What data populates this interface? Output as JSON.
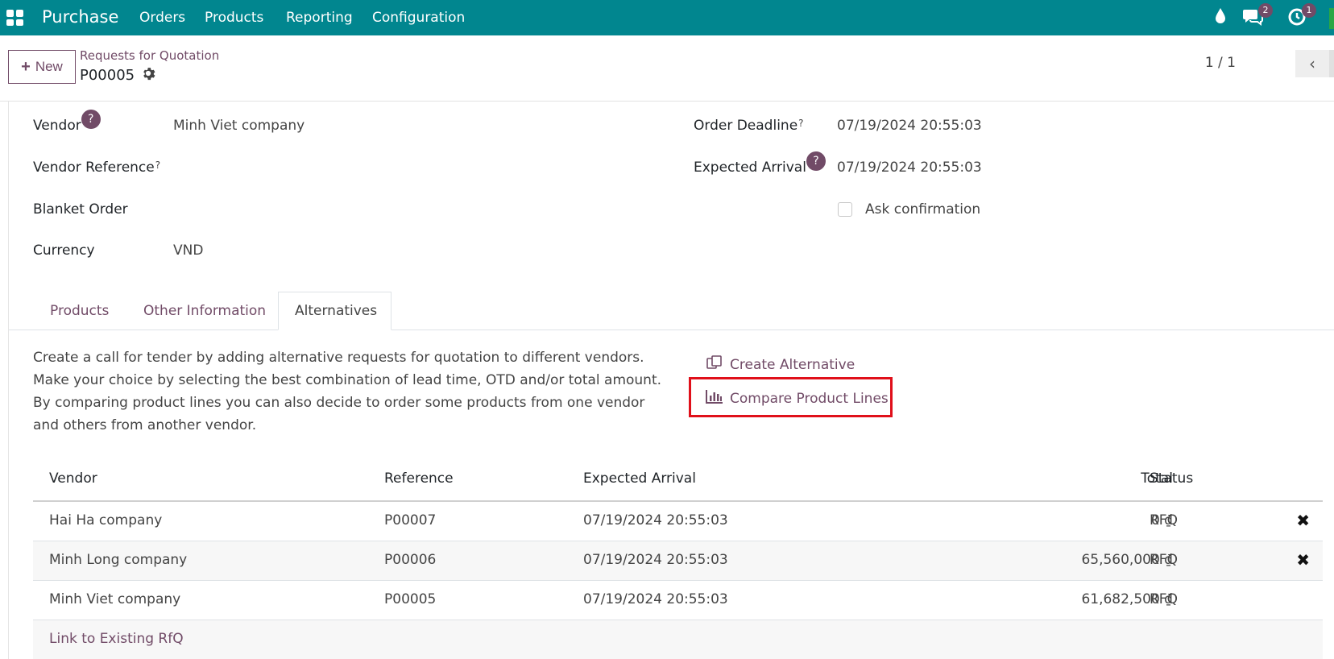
{
  "navbar": {
    "app_name": "Purchase",
    "menu": [
      "Orders",
      "Products",
      "Reporting",
      "Configuration"
    ],
    "messages_badge": "2",
    "activities_badge": "1",
    "color": "#01868f"
  },
  "control_panel": {
    "new_label": "New",
    "breadcrumb": "Requests for Quotation",
    "record_name": "P00005",
    "pager": "1 / 1"
  },
  "form": {
    "vendor_label": "Vendor",
    "vendor_help": "?",
    "vendor_value": "Minh Viet company",
    "vendor_reference_label": "Vendor Reference",
    "help_mark": "?",
    "blanket_order_label": "Blanket Order",
    "currency_label": "Currency",
    "currency_value": "VND",
    "order_deadline_label": "Order Deadline",
    "order_deadline_value": "07/19/2024 20:55:03",
    "expected_arrival_label": "Expected Arrival",
    "expected_arrival_value": "07/19/2024 20:55:03",
    "ask_confirmation_label": "Ask confirmation",
    "ask_confirmation_checked": false
  },
  "tabs": [
    "Products",
    "Other Information",
    "Alternatives"
  ],
  "active_tab": "Alternatives",
  "alternatives": {
    "description": "Create a call for tender by adding alternative requests for quotation to different vendors. Make your choice by selecting the best combination of lead time, OTD and/or total amount. By comparing product lines you can also decide to order some products from one vendor and others from another vendor.",
    "create_alternative": "Create Alternative",
    "compare_product_lines": "Compare Product Lines",
    "table": {
      "columns": [
        "Vendor",
        "Reference",
        "Expected Arrival",
        "Total",
        "Status"
      ],
      "rows": [
        {
          "vendor": "Hai Ha company",
          "reference": "P00007",
          "expected_arrival": "07/19/2024 20:55:03",
          "total": "0 ₫",
          "status": "RFQ",
          "removable": true
        },
        {
          "vendor": "Minh Long company",
          "reference": "P00006",
          "expected_arrival": "07/19/2024 20:55:03",
          "total": "65,560,000 ₫",
          "status": "RFQ",
          "removable": true
        },
        {
          "vendor": "Minh Viet company",
          "reference": "P00005",
          "expected_arrival": "07/19/2024 20:55:03",
          "total": "61,682,500 ₫",
          "status": "RFQ",
          "removable": false
        }
      ],
      "link_label": "Link to Existing RfQ"
    }
  }
}
